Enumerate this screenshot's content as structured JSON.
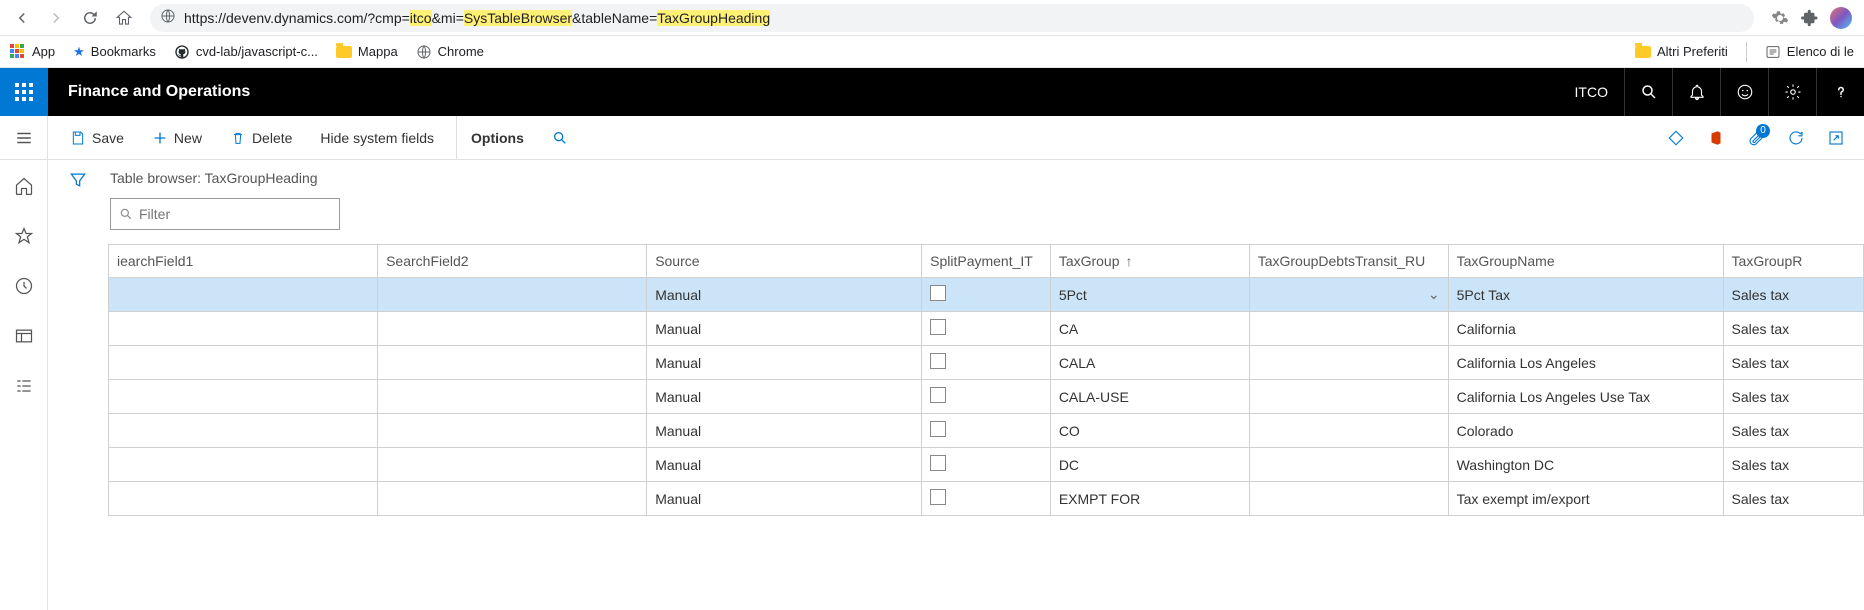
{
  "browser": {
    "url_prefix": "https://devenv.dynamics.com/?cmp=",
    "url_p1": "itco",
    "url_mid1": "&mi=",
    "url_p2": "SysTableBrowser",
    "url_mid2": "&tableName=",
    "url_p3": "TaxGroupHeading"
  },
  "bookmarks": {
    "app": "App",
    "bookmarks": "Bookmarks",
    "cvd": "cvd-lab/javascript-c...",
    "mappa": "Mappa",
    "chrome": "Chrome",
    "altri": "Altri Preferiti",
    "elenco": "Elenco di le"
  },
  "app": {
    "title": "Finance and Operations",
    "company": "ITCO"
  },
  "commands": {
    "save": "Save",
    "new": "New",
    "delete": "Delete",
    "hide": "Hide system fields",
    "options": "Options",
    "attach_badge": "0"
  },
  "page": {
    "title": "Table browser: TaxGroupHeading",
    "filter_placeholder": "Filter"
  },
  "columns": [
    "SearchField1",
    "SearchField2",
    "Source",
    "SplitPayment_IT",
    "TaxGroup",
    "TaxGroupDebtsTransit_RU",
    "TaxGroupName",
    "TaxGroupRounding"
  ],
  "sort_column": "TaxGroup",
  "rows": [
    {
      "SearchField1": "",
      "SearchField2": "",
      "Source": "Manual",
      "SplitPayment_IT": false,
      "TaxGroup": "5Pct",
      "TaxGroupDebtsTransit_RU": "",
      "TaxGroupName": "5Pct Tax",
      "TaxGroupRounding": "Sales tax"
    },
    {
      "SearchField1": "",
      "SearchField2": "",
      "Source": "Manual",
      "SplitPayment_IT": false,
      "TaxGroup": "CA",
      "TaxGroupDebtsTransit_RU": "",
      "TaxGroupName": "California",
      "TaxGroupRounding": "Sales tax"
    },
    {
      "SearchField1": "",
      "SearchField2": "",
      "Source": "Manual",
      "SplitPayment_IT": false,
      "TaxGroup": "CALA",
      "TaxGroupDebtsTransit_RU": "",
      "TaxGroupName": "California Los Angeles",
      "TaxGroupRounding": "Sales tax"
    },
    {
      "SearchField1": "",
      "SearchField2": "",
      "Source": "Manual",
      "SplitPayment_IT": false,
      "TaxGroup": "CALA-USE",
      "TaxGroupDebtsTransit_RU": "",
      "TaxGroupName": "California  Los Angeles Use Tax",
      "TaxGroupRounding": "Sales tax"
    },
    {
      "SearchField1": "",
      "SearchField2": "",
      "Source": "Manual",
      "SplitPayment_IT": false,
      "TaxGroup": "CO",
      "TaxGroupDebtsTransit_RU": "",
      "TaxGroupName": "Colorado",
      "TaxGroupRounding": "Sales tax"
    },
    {
      "SearchField1": "",
      "SearchField2": "",
      "Source": "Manual",
      "SplitPayment_IT": false,
      "TaxGroup": "DC",
      "TaxGroupDebtsTransit_RU": "",
      "TaxGroupName": "Washington DC",
      "TaxGroupRounding": "Sales tax"
    },
    {
      "SearchField1": "",
      "SearchField2": "",
      "Source": "Manual",
      "SplitPayment_IT": false,
      "TaxGroup": "EXMPT FOR",
      "TaxGroupDebtsTransit_RU": "",
      "TaxGroupName": "Tax exempt im/export",
      "TaxGroupRounding": "Sales tax"
    }
  ],
  "selected_row": 0
}
